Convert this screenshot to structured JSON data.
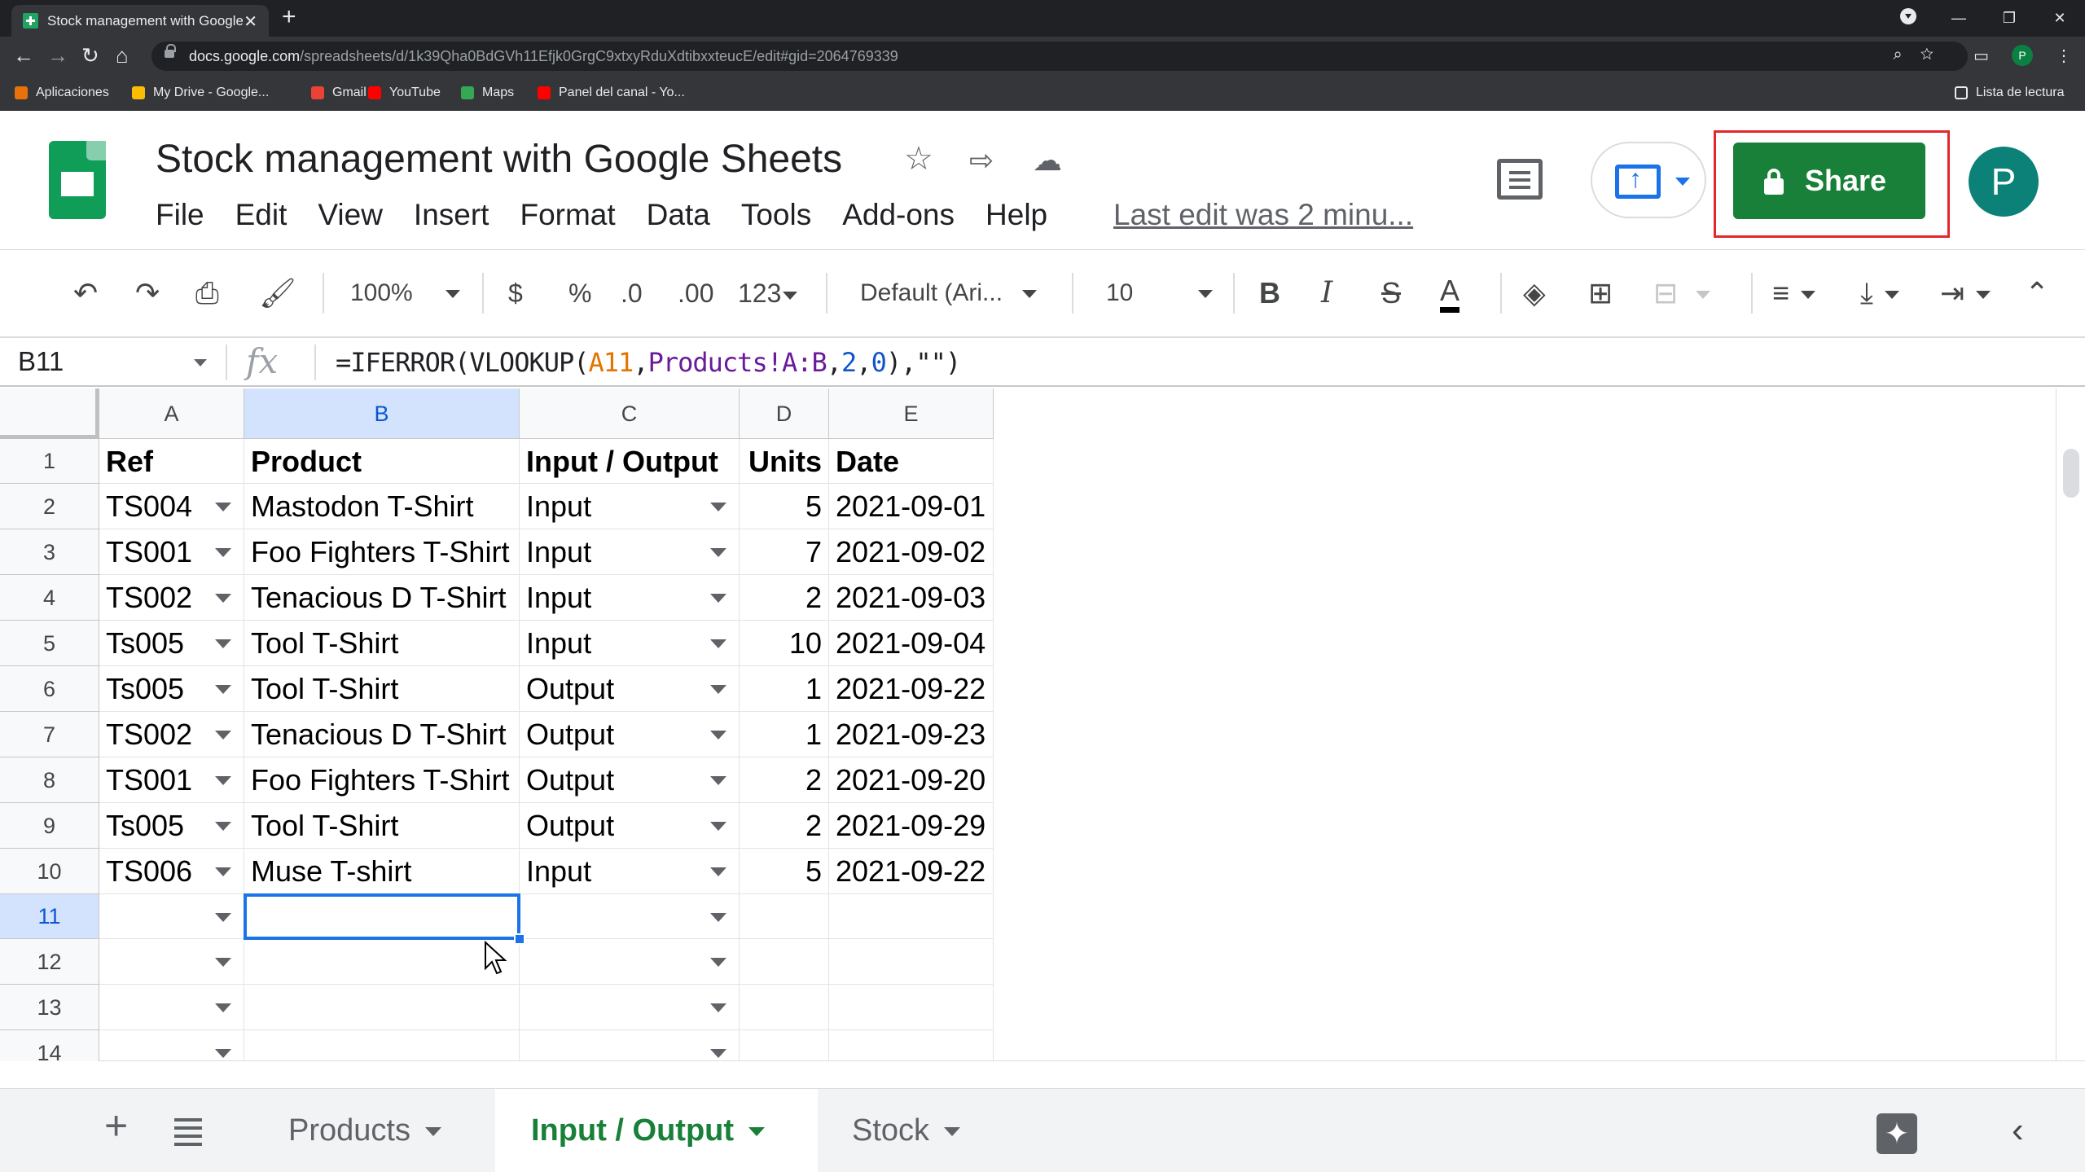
{
  "browser": {
    "tab_title": "Stock management with Google",
    "url_host": "docs.google.com",
    "url_path": "/spreadsheets/d/1k39Qha0BdGVh11Efjk0GrgC9xtxyRduXdtibxxteucE/edit#gid=2064769339",
    "bookmarks": [
      "Aplicaciones",
      "My Drive - Google...",
      "Gmail",
      "YouTube",
      "Maps",
      "Panel del canal - Yo..."
    ],
    "reading_list": "Lista de lectura",
    "profile_initial": "P"
  },
  "doc": {
    "title": "Stock management with Google Sheets",
    "menu": [
      "File",
      "Edit",
      "View",
      "Insert",
      "Format",
      "Data",
      "Tools",
      "Add-ons",
      "Help"
    ],
    "last_edit": "Last edit was 2 minu...",
    "share_label": "Share",
    "avatar_initial": "P"
  },
  "toolbar": {
    "zoom": "100%",
    "currency": "$",
    "percent": "%",
    "dec_decrease": ".0",
    "dec_increase": ".00",
    "more_formats": "123",
    "font": "Default (Ari...",
    "font_size": "10",
    "bold": "B",
    "italic": "I",
    "strike": "S",
    "text_color": "A"
  },
  "formula_bar": {
    "cell_ref": "B11",
    "fx": "fx",
    "formula_parts": [
      "=IFERROR(VLOOKUP(",
      "A11",
      ",",
      "Products!A:B",
      ",",
      "2",
      ",",
      "0",
      "),\"\")"
    ]
  },
  "grid": {
    "columns": [
      "A",
      "B",
      "C",
      "D",
      "E"
    ],
    "rows": [
      "1",
      "2",
      "3",
      "4",
      "5",
      "6",
      "7",
      "8",
      "9",
      "10",
      "11",
      "12",
      "13",
      "14"
    ],
    "header": [
      "Ref",
      "Product",
      "Input / Output",
      "Units",
      "Date"
    ],
    "data": [
      [
        "TS004",
        "Mastodon T-Shirt",
        "Input",
        "5",
        "2021-09-01"
      ],
      [
        "TS001",
        "Foo Fighters T-Shirt",
        "Input",
        "7",
        "2021-09-02"
      ],
      [
        "TS002",
        "Tenacious D T-Shirt",
        "Input",
        "2",
        "2021-09-03"
      ],
      [
        "Ts005",
        "Tool T-Shirt",
        "Input",
        "10",
        "2021-09-04"
      ],
      [
        "Ts005",
        "Tool T-Shirt",
        "Output",
        "1",
        "2021-09-22"
      ],
      [
        "TS002",
        "Tenacious D T-Shirt",
        "Output",
        "1",
        "2021-09-23"
      ],
      [
        "TS001",
        "Foo Fighters T-Shirt",
        "Output",
        "2",
        "2021-09-20"
      ],
      [
        "Ts005",
        "Tool T-Shirt",
        "Output",
        "2",
        "2021-09-29"
      ],
      [
        "TS006",
        "Muse T-shirt",
        "Input",
        "5",
        "2021-09-22"
      ]
    ],
    "selected_cell": "B11"
  },
  "sheets": {
    "tabs": [
      "Products",
      "Input / Output",
      "Stock"
    ],
    "active": "Input / Output"
  },
  "colors": {
    "share_green": "#188038",
    "highlight_red": "#e2282c",
    "selection_blue": "#1a73e8"
  }
}
